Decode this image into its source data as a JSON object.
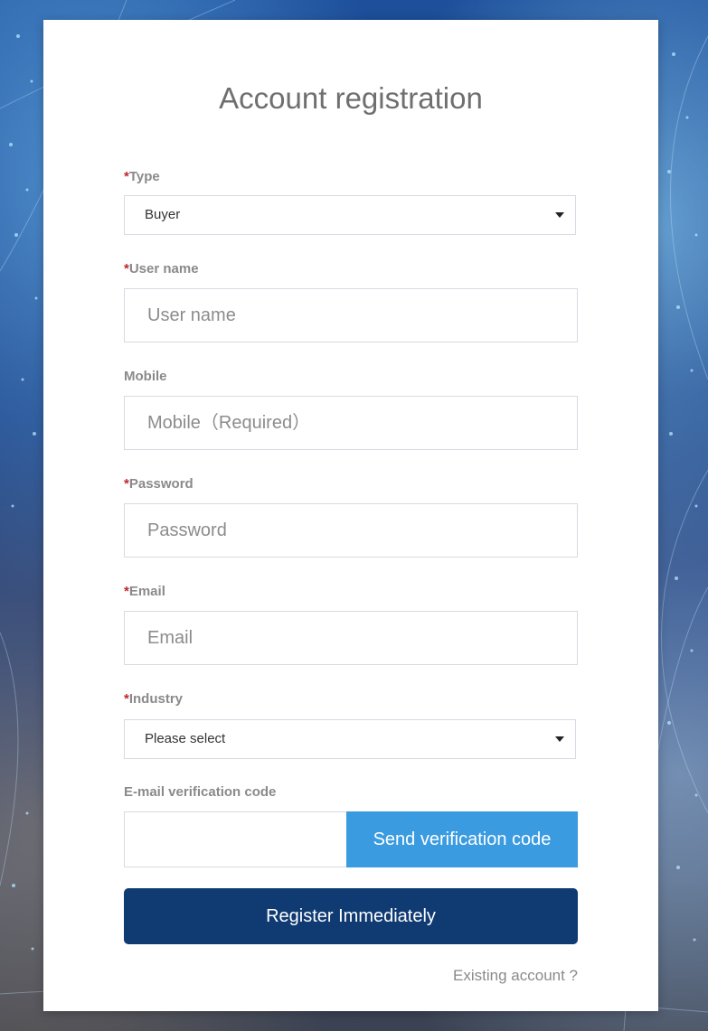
{
  "title": "Account registration",
  "form": {
    "type": {
      "label": "Type",
      "required": "*",
      "value": "Buyer"
    },
    "username": {
      "label": "User name",
      "required": "*",
      "placeholder": "User name"
    },
    "mobile": {
      "label": "Mobile",
      "placeholder": "Mobile（Required）"
    },
    "password": {
      "label": "Password",
      "required": "*",
      "placeholder": "Password"
    },
    "email": {
      "label": "Email",
      "required": "*",
      "placeholder": "Email"
    },
    "industry": {
      "label": "Industry",
      "required": "*",
      "value": "Please select"
    },
    "verification": {
      "label": "E-mail verification code",
      "send_button": "Send verification code"
    }
  },
  "register_button": "Register Immediately",
  "existing_account_link": "Existing account ?",
  "colors": {
    "required": "#c0282a",
    "send_button": "#3a9be0",
    "register_button": "#0f3a72"
  },
  "icons": {
    "select_caret": "caret-down-icon"
  }
}
